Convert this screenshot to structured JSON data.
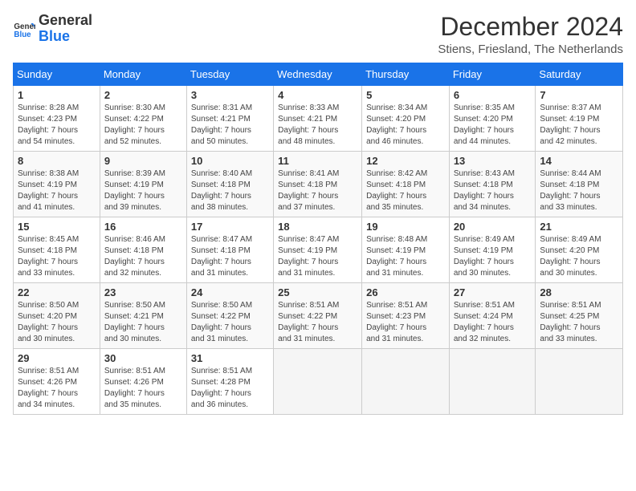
{
  "header": {
    "logo_line1": "General",
    "logo_line2": "Blue",
    "month": "December 2024",
    "location": "Stiens, Friesland, The Netherlands"
  },
  "weekdays": [
    "Sunday",
    "Monday",
    "Tuesday",
    "Wednesday",
    "Thursday",
    "Friday",
    "Saturday"
  ],
  "weeks": [
    [
      {
        "day": "1",
        "sunrise": "8:28 AM",
        "sunset": "4:23 PM",
        "daylight": "7 hours and 54 minutes."
      },
      {
        "day": "2",
        "sunrise": "8:30 AM",
        "sunset": "4:22 PM",
        "daylight": "7 hours and 52 minutes."
      },
      {
        "day": "3",
        "sunrise": "8:31 AM",
        "sunset": "4:21 PM",
        "daylight": "7 hours and 50 minutes."
      },
      {
        "day": "4",
        "sunrise": "8:33 AM",
        "sunset": "4:21 PM",
        "daylight": "7 hours and 48 minutes."
      },
      {
        "day": "5",
        "sunrise": "8:34 AM",
        "sunset": "4:20 PM",
        "daylight": "7 hours and 46 minutes."
      },
      {
        "day": "6",
        "sunrise": "8:35 AM",
        "sunset": "4:20 PM",
        "daylight": "7 hours and 44 minutes."
      },
      {
        "day": "7",
        "sunrise": "8:37 AM",
        "sunset": "4:19 PM",
        "daylight": "7 hours and 42 minutes."
      }
    ],
    [
      {
        "day": "8",
        "sunrise": "8:38 AM",
        "sunset": "4:19 PM",
        "daylight": "7 hours and 41 minutes."
      },
      {
        "day": "9",
        "sunrise": "8:39 AM",
        "sunset": "4:19 PM",
        "daylight": "7 hours and 39 minutes."
      },
      {
        "day": "10",
        "sunrise": "8:40 AM",
        "sunset": "4:18 PM",
        "daylight": "7 hours and 38 minutes."
      },
      {
        "day": "11",
        "sunrise": "8:41 AM",
        "sunset": "4:18 PM",
        "daylight": "7 hours and 37 minutes."
      },
      {
        "day": "12",
        "sunrise": "8:42 AM",
        "sunset": "4:18 PM",
        "daylight": "7 hours and 35 minutes."
      },
      {
        "day": "13",
        "sunrise": "8:43 AM",
        "sunset": "4:18 PM",
        "daylight": "7 hours and 34 minutes."
      },
      {
        "day": "14",
        "sunrise": "8:44 AM",
        "sunset": "4:18 PM",
        "daylight": "7 hours and 33 minutes."
      }
    ],
    [
      {
        "day": "15",
        "sunrise": "8:45 AM",
        "sunset": "4:18 PM",
        "daylight": "7 hours and 33 minutes."
      },
      {
        "day": "16",
        "sunrise": "8:46 AM",
        "sunset": "4:18 PM",
        "daylight": "7 hours and 32 minutes."
      },
      {
        "day": "17",
        "sunrise": "8:47 AM",
        "sunset": "4:18 PM",
        "daylight": "7 hours and 31 minutes."
      },
      {
        "day": "18",
        "sunrise": "8:47 AM",
        "sunset": "4:19 PM",
        "daylight": "7 hours and 31 minutes."
      },
      {
        "day": "19",
        "sunrise": "8:48 AM",
        "sunset": "4:19 PM",
        "daylight": "7 hours and 31 minutes."
      },
      {
        "day": "20",
        "sunrise": "8:49 AM",
        "sunset": "4:19 PM",
        "daylight": "7 hours and 30 minutes."
      },
      {
        "day": "21",
        "sunrise": "8:49 AM",
        "sunset": "4:20 PM",
        "daylight": "7 hours and 30 minutes."
      }
    ],
    [
      {
        "day": "22",
        "sunrise": "8:50 AM",
        "sunset": "4:20 PM",
        "daylight": "7 hours and 30 minutes."
      },
      {
        "day": "23",
        "sunrise": "8:50 AM",
        "sunset": "4:21 PM",
        "daylight": "7 hours and 30 minutes."
      },
      {
        "day": "24",
        "sunrise": "8:50 AM",
        "sunset": "4:22 PM",
        "daylight": "7 hours and 31 minutes."
      },
      {
        "day": "25",
        "sunrise": "8:51 AM",
        "sunset": "4:22 PM",
        "daylight": "7 hours and 31 minutes."
      },
      {
        "day": "26",
        "sunrise": "8:51 AM",
        "sunset": "4:23 PM",
        "daylight": "7 hours and 31 minutes."
      },
      {
        "day": "27",
        "sunrise": "8:51 AM",
        "sunset": "4:24 PM",
        "daylight": "7 hours and 32 minutes."
      },
      {
        "day": "28",
        "sunrise": "8:51 AM",
        "sunset": "4:25 PM",
        "daylight": "7 hours and 33 minutes."
      }
    ],
    [
      {
        "day": "29",
        "sunrise": "8:51 AM",
        "sunset": "4:26 PM",
        "daylight": "7 hours and 34 minutes."
      },
      {
        "day": "30",
        "sunrise": "8:51 AM",
        "sunset": "4:26 PM",
        "daylight": "7 hours and 35 minutes."
      },
      {
        "day": "31",
        "sunrise": "8:51 AM",
        "sunset": "4:28 PM",
        "daylight": "7 hours and 36 minutes."
      },
      null,
      null,
      null,
      null
    ]
  ]
}
